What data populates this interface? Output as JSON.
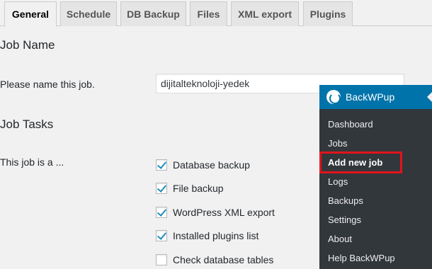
{
  "tabs": [
    {
      "label": "General",
      "active": true
    },
    {
      "label": "Schedule"
    },
    {
      "label": "DB Backup"
    },
    {
      "label": "Files"
    },
    {
      "label": "XML export"
    },
    {
      "label": "Plugins"
    }
  ],
  "job_name": {
    "heading": "Job Name",
    "label": "Please name this job.",
    "value": "dijitalteknoloji-yedek"
  },
  "job_tasks": {
    "heading": "Job Tasks",
    "label": "This job is a ...",
    "tasks": [
      {
        "label": "Database backup",
        "checked": true
      },
      {
        "label": "File backup",
        "checked": true
      },
      {
        "label": "WordPress XML export",
        "checked": true
      },
      {
        "label": "Installed plugins list",
        "checked": true
      },
      {
        "label": "Check database tables",
        "checked": false
      }
    ]
  },
  "flyout": {
    "title": "BackWPup",
    "items": [
      "Dashboard",
      "Jobs",
      "Add new job",
      "Logs",
      "Backups",
      "Settings",
      "About",
      "Help BackWPup"
    ],
    "current": "Add new job"
  },
  "colors": {
    "accent": "#0073aa",
    "menu_bg": "#32373c",
    "highlight": "#e2141c",
    "check": "#1e8cbe"
  }
}
